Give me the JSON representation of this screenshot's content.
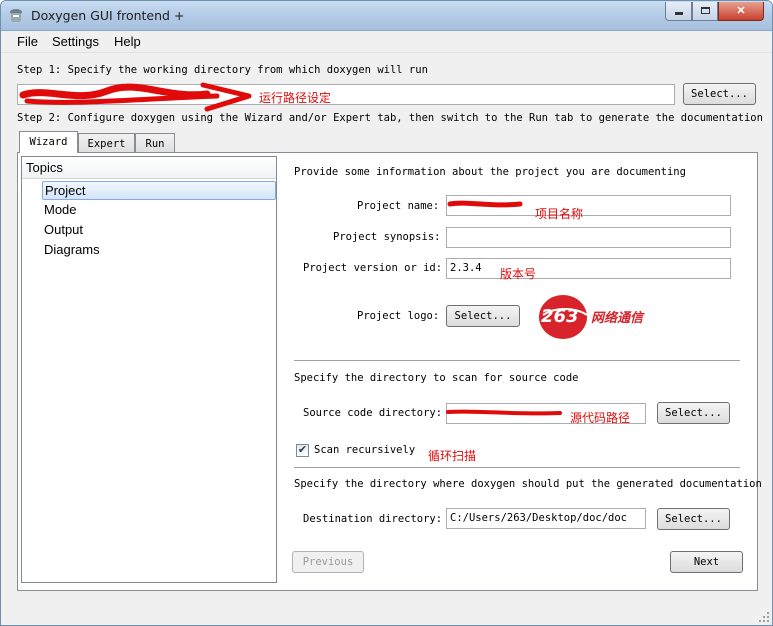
{
  "window": {
    "title": "Doxygen GUI frontend +"
  },
  "menu": [
    "File",
    "Settings",
    "Help"
  ],
  "step1": {
    "label": "Step 1: Specify the working directory from which doxygen will run",
    "working_dir_value": "",
    "select_label": "Select...",
    "annotation": "运行路径设定"
  },
  "step2": {
    "label": "Step 2: Configure doxygen using the Wizard and/or Expert tab, then switch to the Run tab to generate the documentation"
  },
  "tabs": [
    "Wizard",
    "Expert",
    "Run"
  ],
  "topics": {
    "header": "Topics",
    "items": [
      "Project",
      "Mode",
      "Output",
      "Diagrams"
    ],
    "selected": "Project"
  },
  "project": {
    "intro": "Provide some information about the project you are documenting",
    "name_label": "Project name:",
    "name_value": "",
    "name_annotation": "项目名称",
    "synopsis_label": "Project synopsis:",
    "synopsis_value": "",
    "version_label": "Project version or id:",
    "version_value": "2.3.4",
    "version_annotation": "版本号",
    "logo_label": "Project logo:",
    "logo_select": "Select...",
    "logo_brand": "网络通信",
    "logo_number": "263"
  },
  "source": {
    "heading": "Specify the directory to scan for source code",
    "dir_label": "Source code directory:",
    "dir_value": "",
    "dir_annotation": "源代码路径",
    "select_label": "Select...",
    "scan_label": "Scan recursively",
    "scan_checked": true,
    "scan_annotation": "循环扫描"
  },
  "destination": {
    "heading": "Specify the directory where doxygen should put the generated documentation",
    "dir_label": "Destination directory:",
    "dir_value": "C:/Users/263/Desktop/doc/doc",
    "select_label": "Select..."
  },
  "nav": {
    "previous": "Previous",
    "next": "Next"
  },
  "colors": {
    "annotation": "#e10a0a",
    "selection_border": "#84acdd",
    "titlebar": "#b3cbe6"
  }
}
